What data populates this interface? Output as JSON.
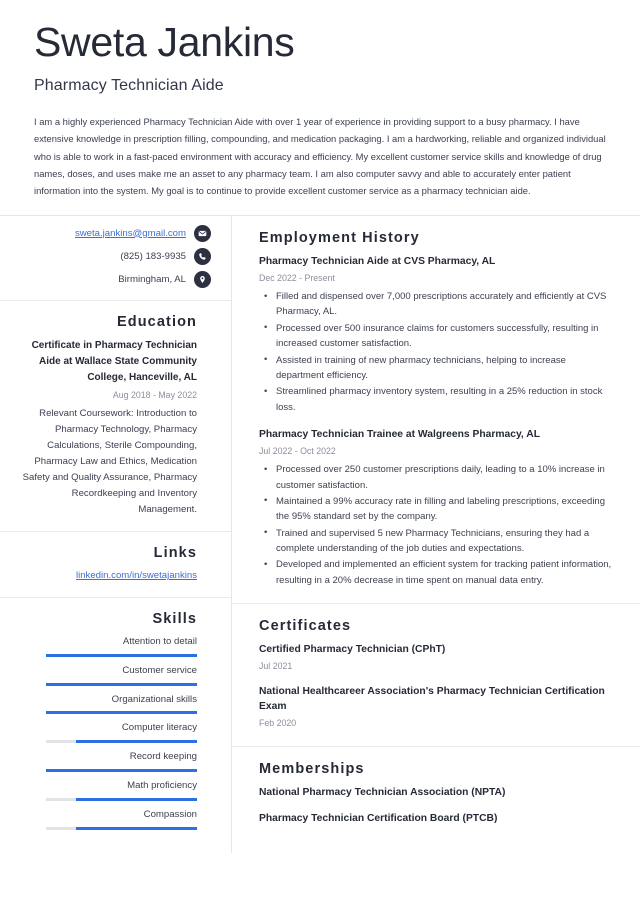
{
  "header": {
    "name": "Sweta Jankins",
    "job_title": "Pharmacy Technician Aide",
    "summary": "I am a highly experienced Pharmacy Technician Aide with over 1 year of experience in providing support to a busy pharmacy. I have extensive knowledge in prescription filling, compounding, and medication packaging. I am a hardworking, reliable and organized individual who is able to work in a fast-paced environment with accuracy and efficiency. My excellent customer service skills and knowledge of drug names, doses, and uses make me an asset to any pharmacy team. I am also computer savvy and able to accurately enter patient information into the system. My goal is to continue to provide excellent customer service as a pharmacy technician aide."
  },
  "contact": {
    "email": "sweta.jankins@gmail.com",
    "phone": "(825) 183-9935",
    "location": "Birmingham, AL",
    "email_icon": "envelope-icon",
    "phone_icon": "phone-icon",
    "location_icon": "map-pin-icon"
  },
  "education": {
    "heading": "Education",
    "degree": "Certificate in Pharmacy Technician Aide at Wallace State Community College, Hanceville, AL",
    "date": "Aug 2018 - May 2022",
    "description": "Relevant Coursework: Introduction to Pharmacy Technology, Pharmacy Calculations, Sterile Compounding, Pharmacy Law and Ethics, Medication Safety and Quality Assurance, Pharmacy Recordkeeping and Inventory Management."
  },
  "links": {
    "heading": "Links",
    "items": [
      {
        "label": "linkedin.com/in/swetajankins"
      }
    ]
  },
  "skills": {
    "heading": "Skills",
    "items": [
      {
        "label": "Attention to detail",
        "level": 100
      },
      {
        "label": "Customer service",
        "level": 100
      },
      {
        "label": "Organizational skills",
        "level": 100
      },
      {
        "label": "Computer literacy",
        "level": 80
      },
      {
        "label": "Record keeping",
        "level": 100
      },
      {
        "label": "Math proficiency",
        "level": 80
      },
      {
        "label": "Compassion",
        "level": 80
      }
    ],
    "bar_fill_color": "#2f6fe4",
    "bar_track_color": "#e2e3e6"
  },
  "employment": {
    "heading": "Employment History",
    "entries": [
      {
        "title": "Pharmacy Technician Aide at CVS Pharmacy, AL",
        "date": "Dec 2022 - Present",
        "bullets": [
          "Filled and dispensed over 7,000 prescriptions accurately and efficiently at CVS Pharmacy, AL.",
          "Processed over 500 insurance claims for customers successfully, resulting in increased customer satisfaction.",
          "Assisted in training of new pharmacy technicians, helping to increase department efficiency.",
          "Streamlined pharmacy inventory system, resulting in a 25% reduction in stock loss."
        ]
      },
      {
        "title": "Pharmacy Technician Trainee at Walgreens Pharmacy, AL",
        "date": "Jul 2022 - Oct 2022",
        "bullets": [
          "Processed over 250 customer prescriptions daily, leading to a 10% increase in customer satisfaction.",
          "Maintained a 99% accuracy rate in filling and labeling prescriptions, exceeding the 95% standard set by the company.",
          "Trained and supervised 5 new Pharmacy Technicians, ensuring they had a complete understanding of the job duties and expectations.",
          "Developed and implemented an efficient system for tracking patient information, resulting in a 20% decrease in time spent on manual data entry."
        ]
      }
    ]
  },
  "certificates": {
    "heading": "Certificates",
    "entries": [
      {
        "title": "Certified Pharmacy Technician (CPhT)",
        "date": "Jul 2021"
      },
      {
        "title": "National Healthcareer Association's Pharmacy Technician Certification Exam",
        "date": "Feb 2020"
      }
    ]
  },
  "memberships": {
    "heading": "Memberships",
    "entries": [
      {
        "title": "National Pharmacy Technician Association (NPTA)"
      },
      {
        "title": "Pharmacy Technician Certification Board (PTCB)"
      }
    ]
  },
  "colors": {
    "accent_link": "#3b6fd4",
    "text_dark": "#262a36",
    "text_body": "#3d4152",
    "text_muted": "#8b8f9c",
    "icon_bg": "#2c3040",
    "divider": "#e6e7ea"
  }
}
